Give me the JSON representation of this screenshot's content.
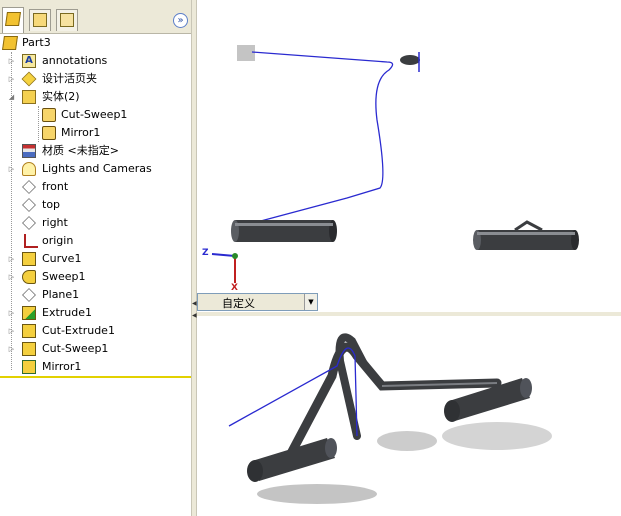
{
  "feature_manager": {
    "tabs": [
      "feature-tree-tab",
      "property-tab",
      "configuration-tab"
    ],
    "expand_glyph": "»",
    "root": "Part3",
    "items": [
      {
        "label": "annotations",
        "icon": "annotations-icon",
        "toggle": "▷"
      },
      {
        "label": "设计活页夹",
        "icon": "design-binder-icon",
        "toggle": "▷"
      },
      {
        "label": "实体(2)",
        "icon": "solid-bodies-icon",
        "toggle": "◢"
      },
      {
        "label": "Cut-Sweep1",
        "icon": "solid-body-icon",
        "toggle": ""
      },
      {
        "label": "Mirror1",
        "icon": "solid-body-icon",
        "toggle": ""
      },
      {
        "label": "材质 <未指定>",
        "icon": "material-icon",
        "toggle": ""
      },
      {
        "label": "Lights and Cameras",
        "icon": "lights-icon",
        "toggle": "▷"
      },
      {
        "label": "front",
        "icon": "plane-icon",
        "toggle": ""
      },
      {
        "label": "top",
        "icon": "plane-icon",
        "toggle": ""
      },
      {
        "label": "right",
        "icon": "plane-icon",
        "toggle": ""
      },
      {
        "label": "origin",
        "icon": "origin-icon",
        "toggle": ""
      },
      {
        "label": "Curve1",
        "icon": "curve-icon",
        "toggle": "▷"
      },
      {
        "label": "Sweep1",
        "icon": "sweep-icon",
        "toggle": "▷"
      },
      {
        "label": "Plane1",
        "icon": "plane-icon",
        "toggle": ""
      },
      {
        "label": "Extrude1",
        "icon": "extrude-icon",
        "toggle": "▷"
      },
      {
        "label": "Cut-Extrude1",
        "icon": "cut-extrude-icon",
        "toggle": "▷"
      },
      {
        "label": "Cut-Sweep1",
        "icon": "cut-sweep-icon",
        "toggle": "▷"
      },
      {
        "label": "Mirror1",
        "icon": "mirror-icon",
        "toggle": ""
      }
    ]
  },
  "viewport": {
    "view_selector": "自定义",
    "triad": {
      "z": "Z",
      "x": "X"
    },
    "sweep_path_color": "#2a2ad0",
    "body_color": "#3b3d40"
  }
}
